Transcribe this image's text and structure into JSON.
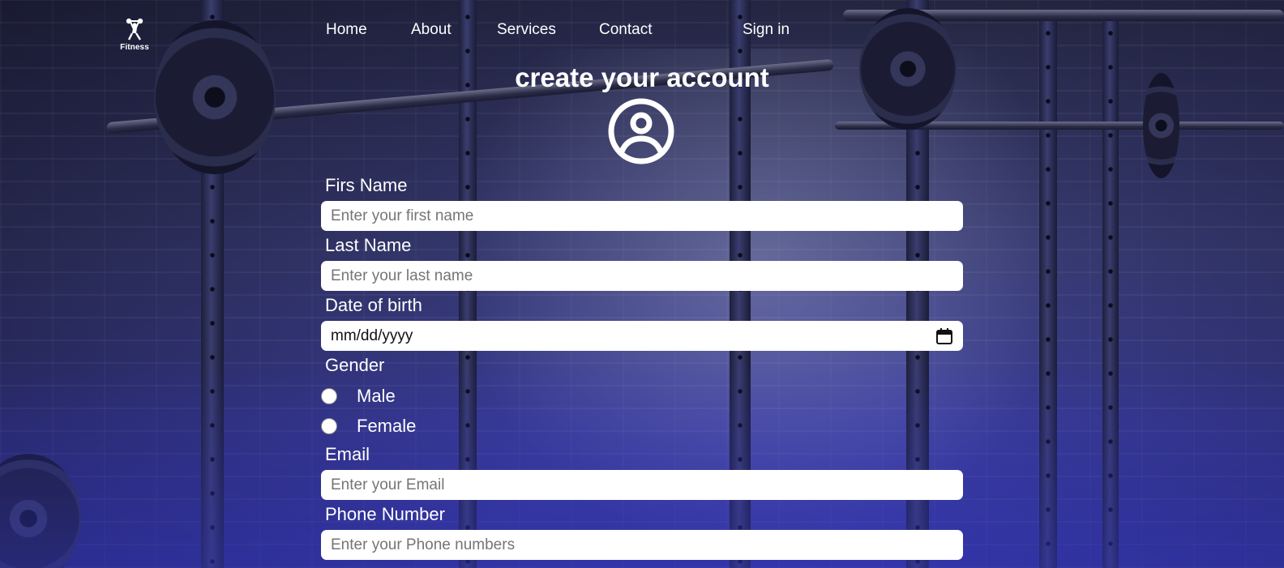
{
  "brand": {
    "logo_text": "Fitness"
  },
  "nav": {
    "links": [
      {
        "label": "Home"
      },
      {
        "label": "About"
      },
      {
        "label": "Services"
      },
      {
        "label": "Contact"
      }
    ],
    "sign_in": "Sign in"
  },
  "form": {
    "title": "create your account",
    "avatar_icon": "user-circle-icon",
    "first_name": {
      "label": "Firs Name",
      "placeholder": "Enter your first name",
      "value": ""
    },
    "last_name": {
      "label": "Last Name",
      "placeholder": "Enter your last name",
      "value": ""
    },
    "dob": {
      "label": "Date of birth",
      "display": "mm/dd/yyyy",
      "icon": "calendar-icon"
    },
    "gender": {
      "label": "Gender",
      "options": [
        {
          "label": "Male",
          "selected": false
        },
        {
          "label": "Female",
          "selected": false
        }
      ]
    },
    "email": {
      "label": "Email",
      "placeholder": "Enter your Email",
      "value": ""
    },
    "phone": {
      "label": "Phone Number",
      "placeholder": "Enter your Phone numbers",
      "value": ""
    }
  },
  "colors": {
    "text": "#ffffff",
    "input_bg": "#ffffff",
    "placeholder": "#757575",
    "background_tint": "#3536a8"
  }
}
